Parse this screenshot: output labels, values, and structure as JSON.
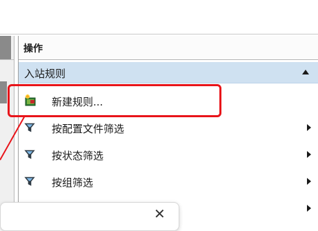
{
  "actions_panel": {
    "title": "操作",
    "section": {
      "label": "入站规则",
      "expanded": true
    },
    "items": [
      {
        "label": "新建规则...",
        "icon": "new-rule-icon",
        "has_submenu": false
      },
      {
        "label": "按配置文件筛选",
        "icon": "filter-icon",
        "has_submenu": true
      },
      {
        "label": "按状态筛选",
        "icon": "filter-icon",
        "has_submenu": true
      },
      {
        "label": "按组筛选",
        "icon": "filter-icon",
        "has_submenu": true
      }
    ],
    "partial_next_item_submenu": true
  },
  "popup": {
    "close_icon": "close-icon"
  },
  "colors": {
    "section_bar": "#cfe1f1",
    "highlight_annotation": "#e8141a"
  }
}
